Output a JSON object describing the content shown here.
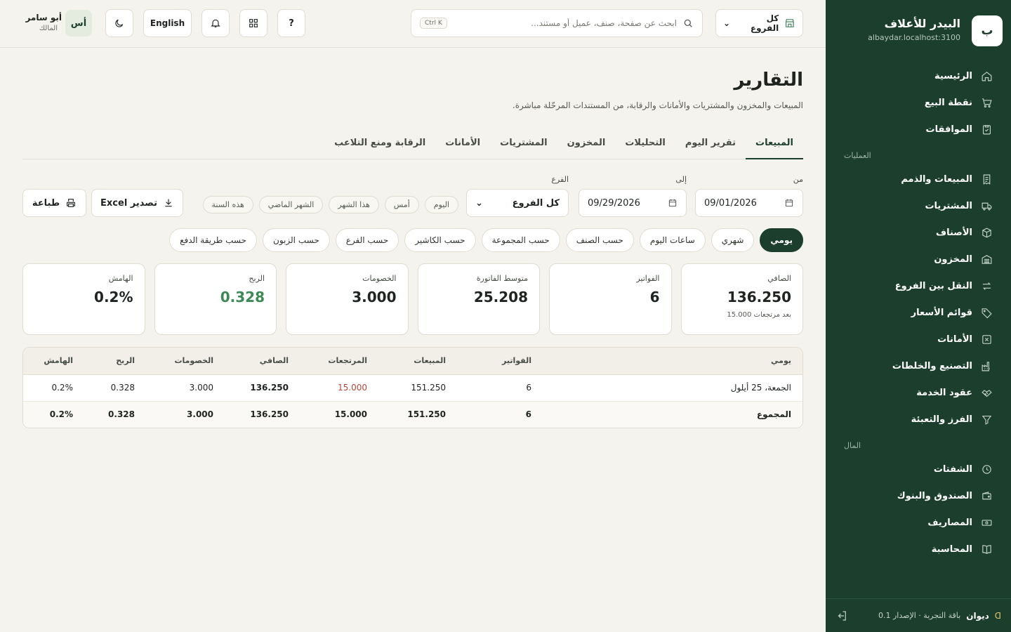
{
  "brand": {
    "logo_letter": "ب",
    "name": "البيدر للأعلاف",
    "domain": "albaydar.localhost:3100"
  },
  "sidebar": {
    "items_top": [
      {
        "label": "الرئيسية",
        "icon": "home-icon"
      },
      {
        "label": "نقطة البيع",
        "icon": "cart-icon"
      },
      {
        "label": "الموافقات",
        "icon": "clipboard-check-icon"
      }
    ],
    "section_operations": "العمليات",
    "items_operations": [
      {
        "label": "المبيعات والذمم",
        "icon": "receipt-icon"
      },
      {
        "label": "المشتريات",
        "icon": "truck-icon"
      },
      {
        "label": "الأصناف",
        "icon": "box-icon"
      },
      {
        "label": "المخزون",
        "icon": "warehouse-icon"
      },
      {
        "label": "النقل بين الفروع",
        "icon": "transfer-icon"
      },
      {
        "label": "قوائم الأسعار",
        "icon": "tag-icon"
      },
      {
        "label": "الأمانات",
        "icon": "x-box-icon"
      },
      {
        "label": "التصنيع والخلطات",
        "icon": "factory-icon"
      },
      {
        "label": "عقود الخدمة",
        "icon": "handshake-icon"
      },
      {
        "label": "الفرز والتعبئة",
        "icon": "filter-icon"
      }
    ],
    "section_money": "المال",
    "items_money": [
      {
        "label": "الشفتات",
        "icon": "clock-icon"
      },
      {
        "label": "الصندوق والبنوك",
        "icon": "wallet-icon"
      },
      {
        "label": "المصاريف",
        "icon": "cash-icon"
      },
      {
        "label": "المحاسبة",
        "icon": "book-icon"
      }
    ],
    "footer": {
      "name": "ديوان",
      "plan": "باقة التجربة · الإصدار 0.1"
    }
  },
  "topbar": {
    "branch_select": "كل الفروع",
    "search_placeholder": "ابحث عن صفحة، صنف، عميل أو مستند...",
    "search_shortcut": "Ctrl K",
    "help_label": "?",
    "language": "English",
    "user": {
      "initials": "أس",
      "name": "أبو سامر",
      "role": "المالك"
    }
  },
  "page": {
    "title": "التقارير",
    "subtitle": "المبيعات والمخزون والمشتريات والأمانات والرقابة، من المستندات المرحّلة مباشرة.",
    "tabs": [
      "المبيعات",
      "تقرير اليوم",
      "التحليلات",
      "المخزون",
      "المشتريات",
      "الأمانات",
      "الرقابة ومنع التلاعب"
    ],
    "active_tab": "المبيعات"
  },
  "filters": {
    "from_label": "من",
    "from_value": "09/01/2026",
    "to_label": "إلى",
    "to_value": "09/29/2026",
    "branch_label": "الفرع",
    "branch_value": "كل الفروع",
    "quick_ranges": [
      "اليوم",
      "أمس",
      "هذا الشهر",
      "الشهر الماضي",
      "هذه السنة"
    ],
    "export_label": "تصدير Excel",
    "print_label": "طباعة"
  },
  "grouping": {
    "options": [
      "يومي",
      "شهري",
      "ساعات اليوم",
      "حسب الصنف",
      "حسب المجموعة",
      "حسب الكاشير",
      "حسب الفرع",
      "حسب الزبون",
      "حسب طريقة الدفع"
    ],
    "active": "يومي"
  },
  "kpis": [
    {
      "label": "الصافي",
      "value": "136.250",
      "note": "بعد مرتجعات 15.000"
    },
    {
      "label": "الفواتير",
      "value": "6"
    },
    {
      "label": "متوسط الفاتورة",
      "value": "25.208"
    },
    {
      "label": "الخصومات",
      "value": "3.000"
    },
    {
      "label": "الربح",
      "value": "0.328",
      "color": "#3b8a55"
    },
    {
      "label": "الهامش",
      "value": "0.2%"
    }
  ],
  "table": {
    "headers": [
      "يومي",
      "الفواتير",
      "المبيعات",
      "المرتجعات",
      "الصافي",
      "الخصومات",
      "الربح",
      "الهامش"
    ],
    "rows": [
      [
        "الجمعة، 25 أيلول",
        "6",
        "151.250",
        "15.000",
        "136.250",
        "3.000",
        "0.328",
        "0.2%"
      ]
    ],
    "total": [
      "المجموع",
      "6",
      "151.250",
      "15.000",
      "136.250",
      "3.000",
      "0.328",
      "0.2%"
    ]
  },
  "colors": {
    "sidebar": "#1b3e2d",
    "accent": "#1b3e2d",
    "profit": "#3b8a55",
    "returns": "#b5463a"
  }
}
